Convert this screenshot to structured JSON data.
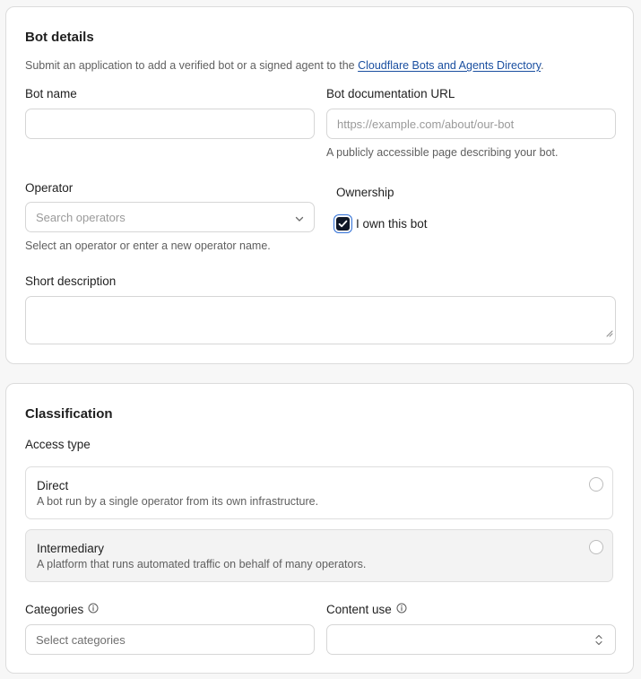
{
  "bot_details": {
    "title": "Bot details",
    "intro_text": "Submit an application to add a verified bot or a signed agent to the ",
    "intro_link": "Cloudflare Bots and Agents Directory",
    "intro_end": ".",
    "bot_name": {
      "label": "Bot name",
      "value": "",
      "placeholder": ""
    },
    "doc_url": {
      "label": "Bot documentation URL",
      "value": "",
      "placeholder": "https://example.com/about/our-bot",
      "help": "A publicly accessible page describing your bot."
    },
    "operator": {
      "label": "Operator",
      "placeholder": "Search operators",
      "help": "Select an operator or enter a new operator name."
    },
    "ownership": {
      "label": "Ownership",
      "checkbox_label": "I own this bot",
      "checked": true
    },
    "short_description": {
      "label": "Short description",
      "value": ""
    }
  },
  "classification": {
    "title": "Classification",
    "access_type_label": "Access type",
    "options": [
      {
        "title": "Direct",
        "description": "A bot run by a single operator from its own infrastructure.",
        "selected": false
      },
      {
        "title": "Intermediary",
        "description": "A platform that runs automated traffic on behalf of many operators.",
        "selected": false,
        "hovered": true
      }
    ],
    "categories": {
      "label": "Categories",
      "placeholder": "Select categories",
      "icon": "info-icon"
    },
    "content_use": {
      "label": "Content use",
      "value": "",
      "icon": "info-icon"
    }
  },
  "colors": {
    "link": "#1a4fa0",
    "checkbox_fill": "#111827",
    "focus_ring": "#2f6fd6",
    "hover_bg": "#f3f3f3"
  }
}
